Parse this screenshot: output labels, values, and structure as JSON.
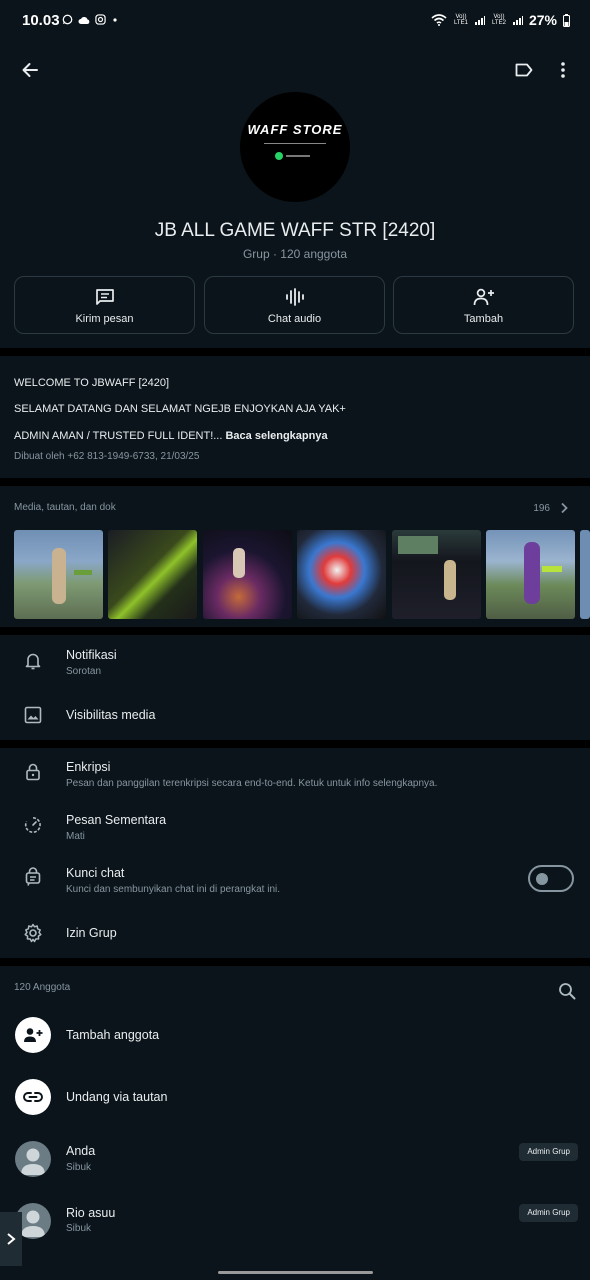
{
  "status_bar": {
    "time": "10.03",
    "battery": "27%",
    "sim1": "Vo)) LTE1",
    "sim2": "Vo)) LTE2"
  },
  "group": {
    "name": "JB ALL GAME WAFF STR [2420]",
    "subtitle": "Grup · 120 anggota",
    "logo_text": "WAFF STORE"
  },
  "actions": [
    {
      "label": "Kirim pesan",
      "icon": "message-icon"
    },
    {
      "label": "Chat audio",
      "icon": "audio-wave-icon"
    },
    {
      "label": "Tambah",
      "icon": "add-person-icon"
    }
  ],
  "description": {
    "line1": "WELCOME TO JBWAFF [2420]",
    "line2": "SELAMAT DATANG DAN SELAMAT NGEJB ENJOYKAN AJA YAK+",
    "line3": "ADMIN AMAN / TRUSTED FULL IDENT!...",
    "read_more": "Baca selengkapnya",
    "meta": "Dibuat oleh +62 813-1949-6733, 21/03/25"
  },
  "media": {
    "label": "Media, tautan, dan dok",
    "count": "196"
  },
  "settings": {
    "notifikasi": {
      "title": "Notifikasi",
      "sub": "Sorotan"
    },
    "visibilitas": {
      "title": "Visibilitas media"
    },
    "enkripsi": {
      "title": "Enkripsi",
      "sub": "Pesan dan panggilan terenkripsi secara end-to-end. Ketuk untuk info selengkapnya."
    },
    "sementara": {
      "title": "Pesan Sementara",
      "sub": "Mati"
    },
    "kunci": {
      "title": "Kunci chat",
      "sub": "Kunci dan sembunyikan chat ini di perangkat ini.",
      "enabled": false
    },
    "izin": {
      "title": "Izin Grup"
    }
  },
  "members": {
    "label": "120 Anggota",
    "add_label": "Tambah anggota",
    "invite_label": "Undang via tautan",
    "list": [
      {
        "name": "Anda",
        "status": "Sibuk",
        "badge": "Admin Grup"
      },
      {
        "name": "Rio asuu",
        "status": "Sibuk",
        "badge": "Admin Grup"
      }
    ]
  },
  "colors": {
    "background": "#0b141a",
    "secondary_text": "#8696a0",
    "accent_green": "#25d366"
  }
}
